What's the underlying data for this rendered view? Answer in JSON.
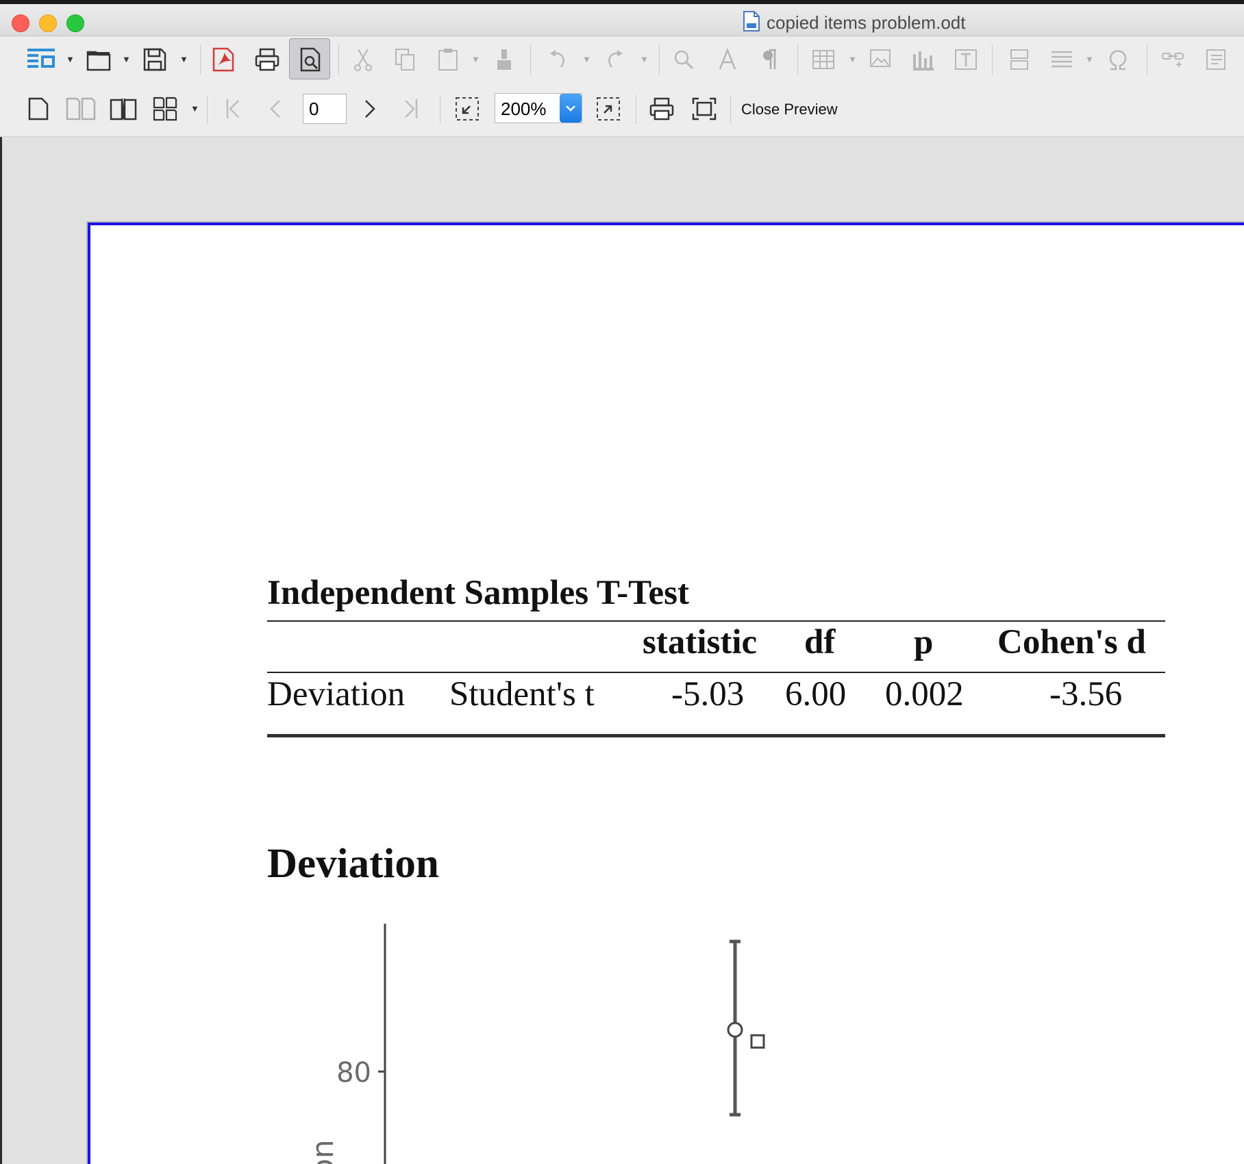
{
  "window": {
    "title": "copied items problem.odt"
  },
  "toolbar": {
    "page_number": "0",
    "zoom": "200%",
    "close_preview_label": "Close Preview",
    "icons": [
      "sidebar-icon",
      "open-icon",
      "save-icon",
      "export-pdf-icon",
      "print-icon",
      "print-preview-icon",
      "cut-icon",
      "copy-icon",
      "paste-icon",
      "clone-formatting-icon",
      "undo-icon",
      "redo-icon",
      "find-icon",
      "spelling-icon",
      "formatting-marks-icon",
      "table-icon",
      "image-icon",
      "chart-icon",
      "textbox-icon",
      "page-break-icon",
      "field-icon",
      "special-character-icon",
      "hyperlink-icon",
      "comment-icon"
    ],
    "preview_icons": [
      "single-page-icon",
      "two-pages-icon",
      "book-view-icon",
      "multiple-pages-icon",
      "first-page-icon",
      "previous-page-icon",
      "next-page-icon",
      "last-page-icon",
      "zoom-out-icon",
      "zoom-in-icon",
      "print-icon",
      "full-screen-icon"
    ]
  },
  "document": {
    "ttest_title": "Independent Samples T-Test",
    "table": {
      "headers": [
        "",
        "",
        "statistic",
        "df",
        "p",
        "Cohen's d"
      ],
      "rows": [
        [
          "Deviation",
          "Student's t",
          "-5.03",
          "6.00",
          "0.002",
          "-3.56"
        ]
      ]
    },
    "plot_title": "Deviation",
    "plot": {
      "y_tick_label": "80",
      "y_axis_label_partial": "on"
    }
  },
  "colors": {
    "selection_border": "#1a12e6",
    "accent_blue": "#1a7be4"
  }
}
